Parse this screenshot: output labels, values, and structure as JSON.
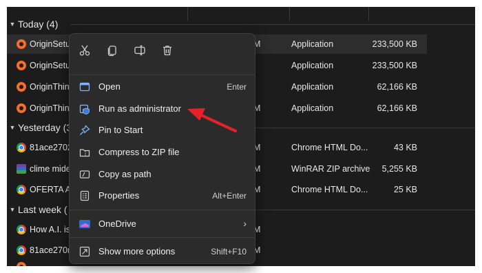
{
  "groups": [
    {
      "label": "Today (4)",
      "chevron": "chevron-down-icon"
    },
    {
      "label": "Yesterday (3",
      "chevron": "chevron-down-icon"
    },
    {
      "label": "Last week (",
      "chevron": "chevron-down-icon"
    }
  ],
  "rows": [
    {
      "name": "OriginSetup",
      "date": "M",
      "type": "Application",
      "size": "233,500 KB",
      "icon": "origin-icon"
    },
    {
      "name": "OriginSetup",
      "date": "",
      "type": "Application",
      "size": "233,500 KB",
      "icon": "origin-icon"
    },
    {
      "name": "OriginThinS",
      "date": "",
      "type": "Application",
      "size": "62,166 KB",
      "icon": "origin-icon"
    },
    {
      "name": "OriginThinS",
      "date": "M",
      "type": "Application",
      "size": "62,166 KB",
      "icon": "origin-icon"
    },
    {
      "name": "81ace27020",
      "date": "M",
      "type": "Chrome HTML Do...",
      "size": "43 KB",
      "icon": "chrome-icon"
    },
    {
      "name": "clime mide",
      "date": "M",
      "type": "WinRAR ZIP archive",
      "size": "5,255 KB",
      "icon": "winrar-icon"
    },
    {
      "name": "OFERTA AP",
      "date": "M",
      "type": "Chrome HTML Do...",
      "size": "25 KB",
      "icon": "chrome-icon"
    },
    {
      "name": "How A.I. is",
      "date": "M",
      "type": "",
      "size": "",
      "icon": "chrome-icon"
    },
    {
      "name": "81ace270m",
      "date": "M",
      "type": "",
      "size": "",
      "icon": "chrome-icon"
    }
  ],
  "context_menu": {
    "toolbar": [
      "cut-icon",
      "copy-icon",
      "rename-icon",
      "delete-icon"
    ],
    "items": [
      {
        "label": "Open",
        "shortcut": "Enter",
        "icon": "open-icon"
      },
      {
        "label": "Run as administrator",
        "shortcut": "",
        "icon": "shield-icon"
      },
      {
        "label": "Pin to Start",
        "shortcut": "",
        "icon": "pin-icon"
      },
      {
        "label": "Compress to ZIP file",
        "shortcut": "",
        "icon": "zip-icon"
      },
      {
        "label": "Copy as path",
        "shortcut": "",
        "icon": "copy-path-icon"
      },
      {
        "label": "Properties",
        "shortcut": "Alt+Enter",
        "icon": "properties-icon"
      },
      {
        "label": "OneDrive",
        "shortcut": "",
        "icon": "onedrive-icon",
        "submenu": "chevron-right-icon"
      },
      {
        "label": "Show more options",
        "shortcut": "Shift+F10",
        "icon": "more-options-icon"
      }
    ]
  },
  "colors": {
    "background": "#1c1c1c",
    "menu": "#2b2b2b",
    "arrow": "#e8202a",
    "origin": "#f56c2d"
  }
}
